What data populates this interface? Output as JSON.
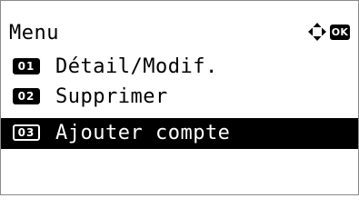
{
  "menu": {
    "title": "Menu",
    "nav_icon": "four-way-arrows-icon",
    "ok_label": "OK",
    "items": [
      {
        "num": "01",
        "label": "Détail/Modif.",
        "selected": false
      },
      {
        "num": "02",
        "label": "Supprimer",
        "selected": false
      },
      {
        "num": "03",
        "label": "Ajouter compte",
        "selected": true
      }
    ]
  },
  "colors": {
    "foreground": "#000000",
    "background": "#ffffff",
    "border": "#8a8a8a"
  }
}
